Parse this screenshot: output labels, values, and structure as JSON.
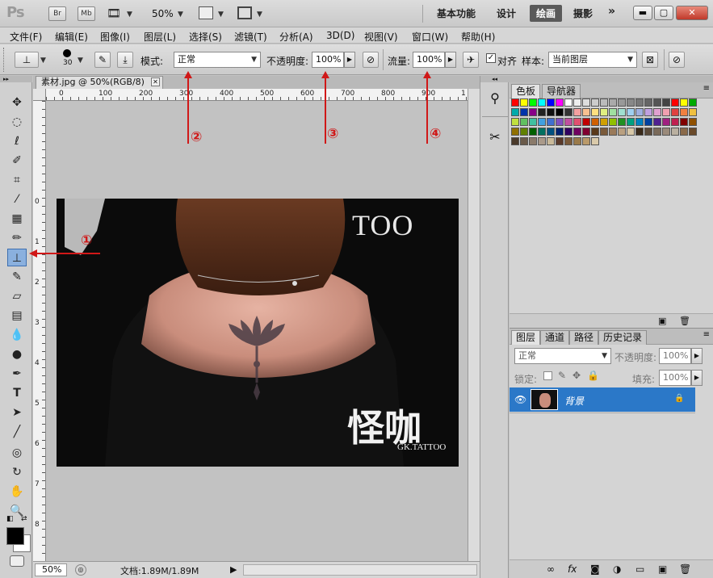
{
  "title_bar": {
    "logo": "Ps",
    "bridge_button": "Br",
    "minibridge_button": "Mb",
    "zoom": "50%",
    "workspaces": [
      "基本功能",
      "设计",
      "绘画",
      "摄影"
    ],
    "active_workspace": "绘画",
    "more": "»"
  },
  "menu": [
    "文件(F)",
    "编辑(E)",
    "图像(I)",
    "图层(L)",
    "选择(S)",
    "滤镜(T)",
    "分析(A)",
    "3D(D)",
    "视图(V)",
    "窗口(W)",
    "帮助(H)"
  ],
  "options_bar": {
    "brush_size": "30",
    "mode_label": "模式:",
    "mode_value": "正常",
    "opacity_label": "不透明度:",
    "opacity_value": "100%",
    "flow_label": "流量:",
    "flow_value": "100%",
    "aligned_label": "对齐",
    "aligned_checked": true,
    "sample_label": "样本:",
    "sample_value": "当前图层"
  },
  "document": {
    "tab_title": "素材.jpg @ 50%(RGB/8)",
    "ruler_top_ticks": [
      "0",
      "100",
      "200",
      "300",
      "400",
      "500",
      "600",
      "700",
      "800",
      "900",
      "1"
    ],
    "ruler_left_ticks": [
      "0",
      "1",
      "2",
      "3",
      "4",
      "5",
      "6",
      "7",
      "8",
      "9",
      "1"
    ],
    "image_text_tattoo": "TOO",
    "watermark_cn": "怪咖",
    "watermark_en": "GK.TATTOO"
  },
  "status_bar": {
    "zoom": "50%",
    "doc_info": "文档:1.89M/1.89M"
  },
  "color_panel": {
    "tabs": [
      "色板",
      "导航器"
    ],
    "active_tab": "色板",
    "swatch_rows": [
      [
        "#ff0000",
        "#ffff00",
        "#00ff00",
        "#00ffff",
        "#0000ff",
        "#ff00ff",
        "#ffffff",
        "#eeeeee",
        "#dddddd",
        "#cccccc",
        "#bbbbbb",
        "#aaaaaa",
        "#999999",
        "#888888",
        "#777777",
        "#666666",
        "#555555",
        "#444444",
        "#ff0000",
        "#ffff00",
        "#00aa00"
      ],
      [
        "#00aaaa",
        "#0033aa",
        "#880088",
        "#222222",
        "#111111",
        "#000000",
        "#333333",
        "#f4a0a0",
        "#f8c090",
        "#ffe080",
        "#e0f080",
        "#a0e0a0",
        "#a0e0d0",
        "#a0d0f0",
        "#a0b0e0",
        "#c0a0e0",
        "#e0a0d0",
        "#f0a0b0",
        "#e04040",
        "#f08040",
        "#f0c040"
      ],
      [
        "#c0e040",
        "#60c060",
        "#40c0a0",
        "#40a0e0",
        "#4070d0",
        "#8050c0",
        "#c050a0",
        "#e05070",
        "#c00000",
        "#d06000",
        "#d0a000",
        "#90c000",
        "#209020",
        "#00a080",
        "#0080c0",
        "#0040a0",
        "#502090",
        "#a02080",
        "#c02050",
        "#800000",
        "#905000"
      ],
      [
        "#907000",
        "#608000",
        "#006000",
        "#007060",
        "#005080",
        "#002070",
        "#300060",
        "#700060",
        "#800030",
        "#5a3a1a",
        "#7a5a3a",
        "#9a7a5a",
        "#baa080",
        "#d8c8a8",
        "#3a2a1a",
        "#5a4a3a",
        "#7a6a5a",
        "#9a8a7a",
        "#bab0a0",
        "#8a6a4a",
        "#6a4a2a"
      ]
    ]
  },
  "layers_panel": {
    "tabs": [
      "图层",
      "通道",
      "路径",
      "历史记录"
    ],
    "active_tab": "图层",
    "blend_mode": "正常",
    "opacity_label": "不透明度:",
    "opacity_value": "100%",
    "lock_label": "锁定:",
    "fill_label": "填充:",
    "fill_value": "100%",
    "layer_name": "背景"
  },
  "annotations": [
    "①",
    "②",
    "③",
    "④"
  ]
}
